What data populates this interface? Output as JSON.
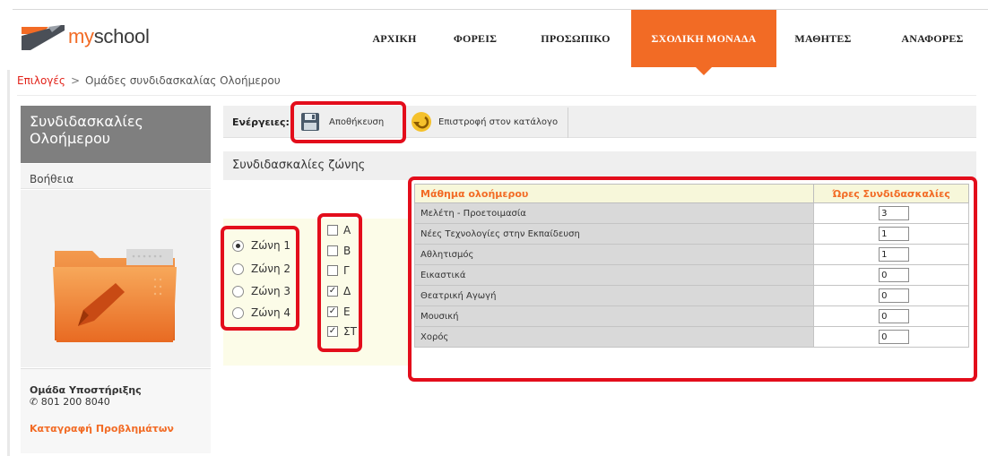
{
  "logo": {
    "my": "my",
    "school": "school"
  },
  "nav": [
    {
      "label": "ΑΡΧΙΚΗ"
    },
    {
      "label": "ΦΟΡΕΙΣ"
    },
    {
      "label": "ΠΡΟΣΩΠΙΚΟ"
    },
    {
      "label": "ΣΧΟΛΙΚΗ ΜΟΝΑΔΑ",
      "active": true
    },
    {
      "label": "ΜΑΘΗΤΕΣ"
    },
    {
      "label": "ΑΝΑΦΟΡΕΣ"
    }
  ],
  "breadcrumb": {
    "link": "Επιλογές",
    "separator": ">",
    "current": "Ομάδες συνδιδασκαλίας Ολοήμερου"
  },
  "sidebar": {
    "title": "Συνδιδασκαλίες Ολοήμερου",
    "help": "Βοήθεια",
    "support_title": "Ομάδα Υποστήριξης",
    "support_phone": "801 200 8040",
    "report_link": "Καταγραφή Προβλημάτων"
  },
  "toolbar": {
    "label": "Ενέργειες:",
    "save_label": "Αποθήκευση",
    "back_label": "Επιστροφή στον κατάλογο"
  },
  "section": {
    "title": "Συνδιδασκαλίες ζώνης"
  },
  "zones": [
    {
      "label": "Ζώνη 1",
      "selected": true
    },
    {
      "label": "Ζώνη 2",
      "selected": false
    },
    {
      "label": "Ζώνη 3",
      "selected": false
    },
    {
      "label": "Ζώνη 4",
      "selected": false
    }
  ],
  "classes": [
    {
      "label": "Α",
      "checked": false
    },
    {
      "label": "Β",
      "checked": false
    },
    {
      "label": "Γ",
      "checked": false
    },
    {
      "label": "Δ",
      "checked": true
    },
    {
      "label": "Ε",
      "checked": true
    },
    {
      "label": "ΣΤ",
      "checked": true
    }
  ],
  "table": {
    "col_subject": "Μάθημα ολοήμερου",
    "col_hours": "Ώρες Συνδιδασκαλίες",
    "rows": [
      {
        "subject": "Μελέτη - Προετοιμασία",
        "hours": "3"
      },
      {
        "subject": "Νέες Τεχνολογίες στην Εκπαίδευση",
        "hours": "1"
      },
      {
        "subject": "Αθλητισμός",
        "hours": "1"
      },
      {
        "subject": "Εικαστικά",
        "hours": "0"
      },
      {
        "subject": "Θεατρική Αγωγή",
        "hours": "0"
      },
      {
        "subject": "Μουσική",
        "hours": "0"
      },
      {
        "subject": "Χορός",
        "hours": "0"
      }
    ]
  },
  "colors": {
    "accent": "#f26b25",
    "highlight": "#e30d1b",
    "link": "#e2231a"
  }
}
